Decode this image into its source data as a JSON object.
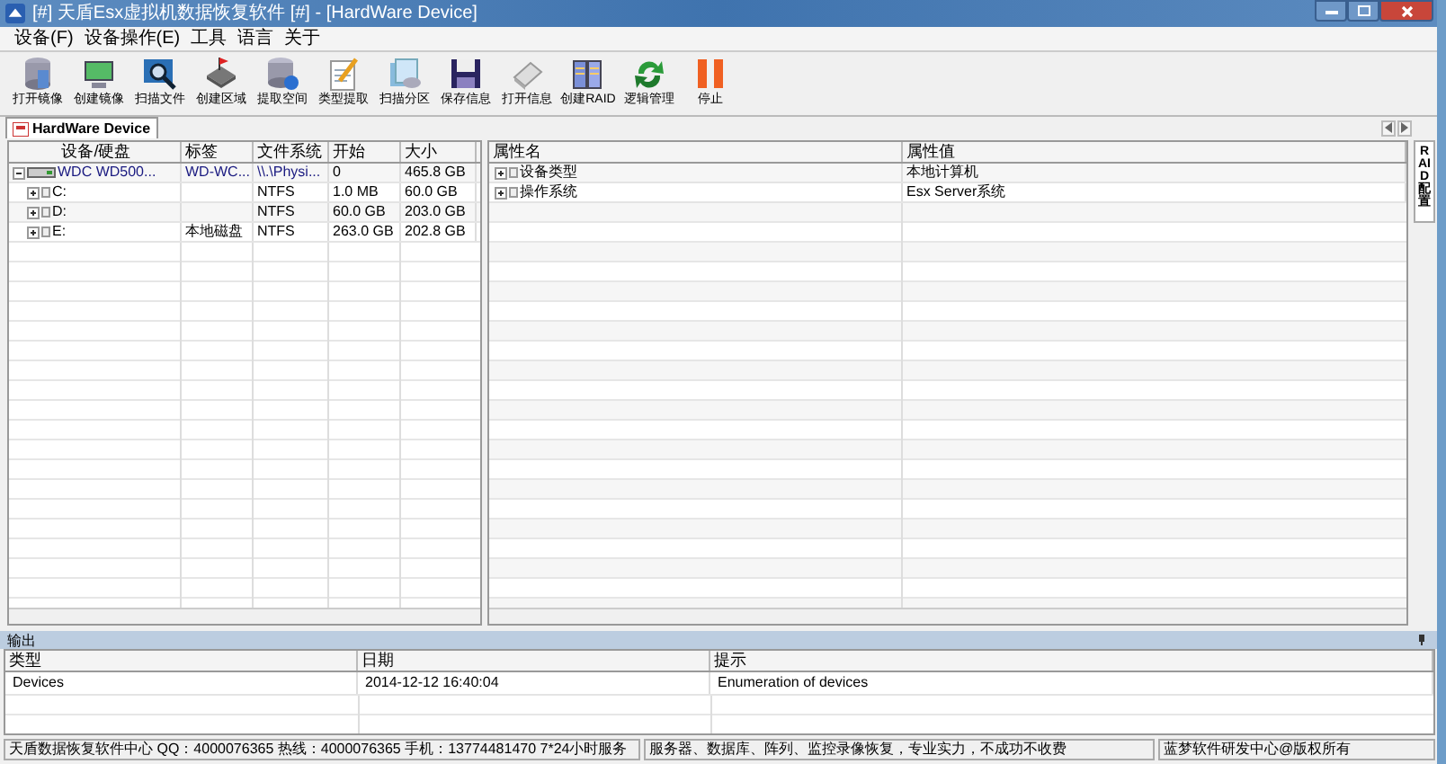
{
  "window": {
    "title": "[#] 天盾Esx虚拟机数据恢复软件 [#] - [HardWare Device]"
  },
  "menu": [
    "设备(F)",
    "设备操作(E)",
    "工具",
    "语言",
    "关于"
  ],
  "toolbar": [
    "打开镜像",
    "创建镜像",
    "扫描文件",
    "创建区域",
    "提取空间",
    "类型提取",
    "扫描分区",
    "保存信息",
    "打开信息",
    "创建RAID",
    "逻辑管理",
    "停止"
  ],
  "doc_tab": {
    "label": "HardWare Device"
  },
  "side_tab": "RAID配置",
  "devices": {
    "columns": [
      "设备/硬盘",
      "标签",
      "文件系统",
      "开始",
      "大小"
    ],
    "rows": [
      {
        "cells": [
          "WDC WD500...",
          "WD-WC...",
          "\\\\.\\Physi...",
          "0",
          "465.8 GB"
        ],
        "expanded": true,
        "children": [
          {
            "cells": [
              "C:",
              "",
              "NTFS",
              "1.0 MB",
              "60.0 GB"
            ],
            "expanded": false
          },
          {
            "cells": [
              "D:",
              "",
              "NTFS",
              "60.0 GB",
              "203.0 GB"
            ],
            "expanded": false
          },
          {
            "cells": [
              "E:",
              "本地磁盘",
              "NTFS",
              "263.0 GB",
              "202.8 GB"
            ],
            "expanded": false
          }
        ]
      }
    ]
  },
  "properties": {
    "columns": [
      "属性名",
      "属性值"
    ],
    "rows": [
      {
        "name": "设备类型",
        "value": "本地计算机",
        "expanded": false
      },
      {
        "name": "操作系统",
        "value": "Esx Server系统",
        "expanded": false
      }
    ]
  },
  "output": {
    "title": "输出",
    "columns": [
      "类型",
      "日期",
      "提示"
    ],
    "rows": [
      [
        "Devices",
        "2014-12-12 16:40:04",
        "Enumeration of devices"
      ]
    ]
  },
  "status_bar": [
    "天盾数据恢复软件中心 QQ：4000076365 热线：4000076365 手机：13774481470   7*24小时服务",
    "服务器、数据库、阵列、监控录像恢复，专业实力，不成功不收费",
    "蓝梦软件研发中心@版权所有"
  ]
}
